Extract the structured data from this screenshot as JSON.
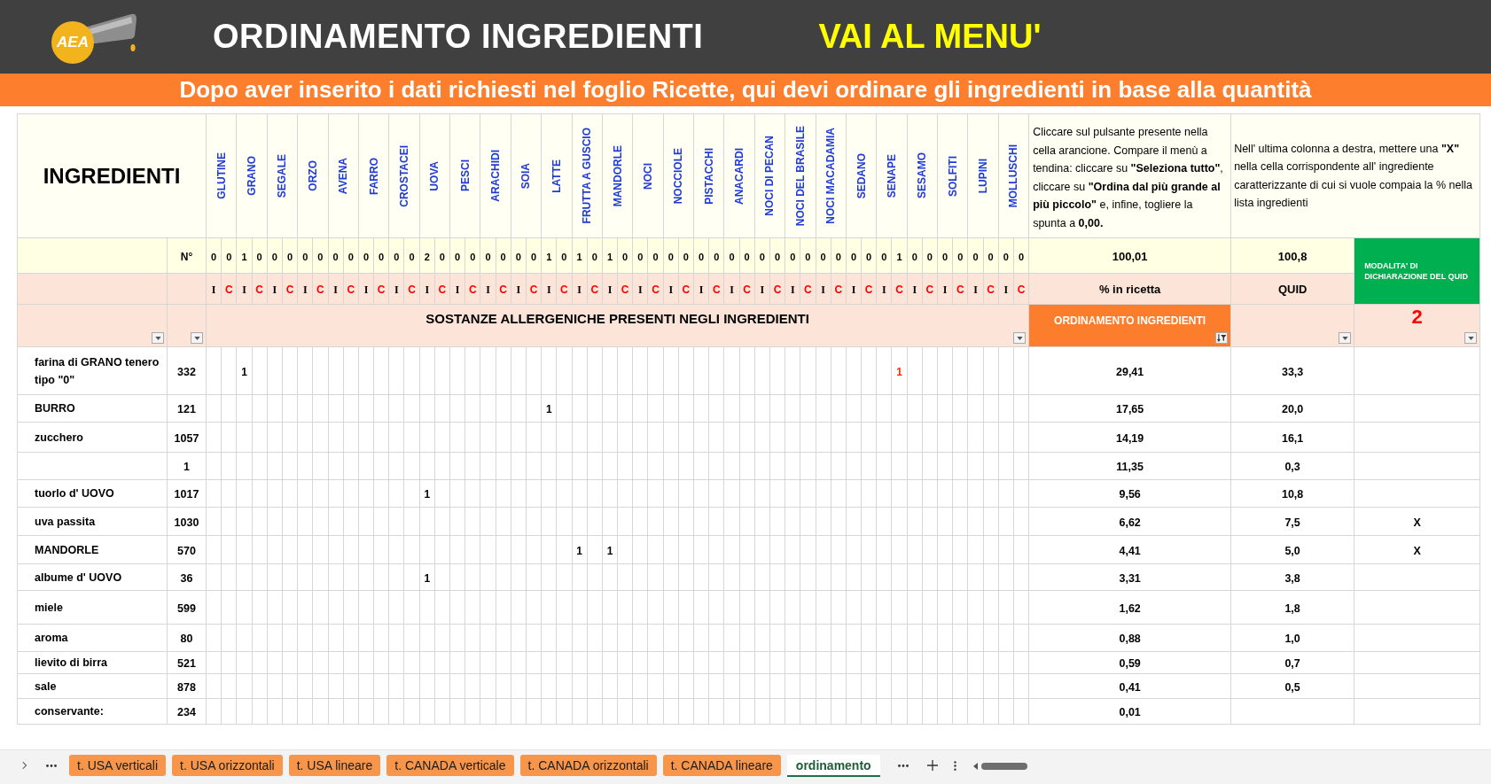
{
  "header": {
    "logo_text": "AEA",
    "title": "ORDINAMENTO INGREDIENTI",
    "menu_link": "VAI AL MENU'"
  },
  "banner": "Dopo aver inserito i dati richiesti nel foglio Ricette, qui devi ordinare gli ingredienti in base alla quantità",
  "table": {
    "ingredients_heading": "INGREDIENTI",
    "allergens": [
      {
        "name": "GLUTINE",
        "subcolumns": [
          {
            "kind": "I",
            "label": "I",
            "count": "0"
          },
          {
            "kind": "C",
            "label": "C",
            "count": "0"
          }
        ]
      },
      {
        "name": "GRANO",
        "subcolumns": [
          {
            "kind": "I",
            "label": "I",
            "count": "1"
          },
          {
            "kind": "C",
            "label": "C",
            "count": "0"
          }
        ]
      },
      {
        "name": "SEGALE",
        "subcolumns": [
          {
            "kind": "I",
            "label": "I",
            "count": "0"
          },
          {
            "kind": "C",
            "label": "C",
            "count": "0"
          }
        ]
      },
      {
        "name": "ORZO",
        "subcolumns": [
          {
            "kind": "I",
            "label": "I",
            "count": "0"
          },
          {
            "kind": "C",
            "label": "C",
            "count": "0"
          }
        ]
      },
      {
        "name": "AVENA",
        "subcolumns": [
          {
            "kind": "I",
            "label": "I",
            "count": "0"
          },
          {
            "kind": "C",
            "label": "C",
            "count": "0"
          }
        ]
      },
      {
        "name": "FARRO",
        "subcolumns": [
          {
            "kind": "I",
            "label": "I",
            "count": "0"
          },
          {
            "kind": "C",
            "label": "C",
            "count": "0"
          }
        ]
      },
      {
        "name": "CROSTACEI",
        "subcolumns": [
          {
            "kind": "I",
            "label": "I",
            "count": "0"
          },
          {
            "kind": "C",
            "label": "C",
            "count": "0"
          }
        ]
      },
      {
        "name": "UOVA",
        "subcolumns": [
          {
            "kind": "I",
            "label": "I",
            "count": "2"
          },
          {
            "kind": "C",
            "label": "C",
            "count": "0"
          }
        ]
      },
      {
        "name": "PESCI",
        "subcolumns": [
          {
            "kind": "I",
            "label": "I",
            "count": "0"
          },
          {
            "kind": "C",
            "label": "C",
            "count": "0"
          }
        ]
      },
      {
        "name": "ARACHIDI",
        "subcolumns": [
          {
            "kind": "I",
            "label": "I",
            "count": "0"
          },
          {
            "kind": "C",
            "label": "C",
            "count": "0"
          }
        ]
      },
      {
        "name": "SOIA",
        "subcolumns": [
          {
            "kind": "I",
            "label": "I",
            "count": "0"
          },
          {
            "kind": "C",
            "label": "C",
            "count": "0"
          }
        ]
      },
      {
        "name": "LATTE",
        "subcolumns": [
          {
            "kind": "I",
            "label": "I",
            "count": "1"
          },
          {
            "kind": "C",
            "label": "C",
            "count": "0"
          }
        ]
      },
      {
        "name": "FRUTTA A GUSCIO",
        "subcolumns": [
          {
            "kind": "I",
            "label": "I",
            "count": "1"
          },
          {
            "kind": "C",
            "label": "C",
            "count": "0"
          }
        ]
      },
      {
        "name": "MANDORLE",
        "subcolumns": [
          {
            "kind": "I",
            "label": "I",
            "count": "1"
          },
          {
            "kind": "C",
            "label": "C",
            "count": "0"
          }
        ]
      },
      {
        "name": "NOCI",
        "subcolumns": [
          {
            "kind": "I",
            "label": "I",
            "count": "0"
          },
          {
            "kind": "C",
            "label": "C",
            "count": "0"
          }
        ]
      },
      {
        "name": "NOCCIOLE",
        "subcolumns": [
          {
            "kind": "I",
            "label": "I",
            "count": "0"
          },
          {
            "kind": "C",
            "label": "C",
            "count": "0"
          }
        ]
      },
      {
        "name": "PISTACCHI",
        "subcolumns": [
          {
            "kind": "I",
            "label": "I",
            "count": "0"
          },
          {
            "kind": "C",
            "label": "C",
            "count": "0"
          }
        ]
      },
      {
        "name": "ANACARDI",
        "subcolumns": [
          {
            "kind": "I",
            "label": "I",
            "count": "0"
          },
          {
            "kind": "C",
            "label": "C",
            "count": "0"
          }
        ]
      },
      {
        "name": "NOCI DI PECAN",
        "subcolumns": [
          {
            "kind": "I",
            "label": "I",
            "count": "0"
          },
          {
            "kind": "C",
            "label": "C",
            "count": "0"
          }
        ]
      },
      {
        "name": "NOCI DEL BRASILE",
        "subcolumns": [
          {
            "kind": "I",
            "label": "I",
            "count": "0"
          },
          {
            "kind": "C",
            "label": "C",
            "count": "0"
          }
        ]
      },
      {
        "name": "NOCI MACADAMIA",
        "subcolumns": [
          {
            "kind": "I",
            "label": "I",
            "count": "0"
          },
          {
            "kind": "C",
            "label": "C",
            "count": "0"
          }
        ]
      },
      {
        "name": "SEDANO",
        "subcolumns": [
          {
            "kind": "I",
            "label": "I",
            "count": "0"
          },
          {
            "kind": "C",
            "label": "C",
            "count": "0"
          }
        ]
      },
      {
        "name": "SENAPE",
        "subcolumns": [
          {
            "kind": "I",
            "label": "I",
            "count": "0"
          },
          {
            "kind": "C",
            "label": "C",
            "count": "1"
          }
        ]
      },
      {
        "name": "SESAMO",
        "subcolumns": [
          {
            "kind": "I",
            "label": "I",
            "count": "0"
          },
          {
            "kind": "C",
            "label": "C",
            "count": "0"
          }
        ]
      },
      {
        "name": "SOLFITI",
        "subcolumns": [
          {
            "kind": "I",
            "label": "I",
            "count": "0"
          },
          {
            "kind": "C",
            "label": "C",
            "count": "0"
          }
        ]
      },
      {
        "name": "LUPINI",
        "subcolumns": [
          {
            "kind": "I",
            "label": "I",
            "count": "0"
          },
          {
            "kind": "C",
            "label": "C",
            "count": "0"
          }
        ]
      },
      {
        "name": "MOLLUSCHI",
        "subcolumns": [
          {
            "kind": "I",
            "label": "I",
            "count": "0"
          },
          {
            "kind": "C",
            "label": "C",
            "count": "0"
          }
        ]
      }
    ],
    "percent_note": "Cliccare sul pulsante presente nella cella arancione. Compare il menù a tendina: cliccare su **\"Seleziona tutto\"**, cliccare su **\"Ordina dal più grande al più piccolo\"** e, infine, togliere la spunta a **0,00.**",
    "quid_note": "Nell' ultima colonna a destra, mettere una **\"X\"** nella cella corrispondente all' ingrediente caratterizzante di cui si vuole compaia la % nella lista ingredienti",
    "count_label": "N°",
    "percent_total": "100,01",
    "quid_total": "100,8",
    "percent_heading": "% in ricetta",
    "quid_heading": "QUID",
    "quid_mode_heading": "MODALITA' DI DICHIARAZIONE DEL QUID",
    "allergens_heading": "SOSTANZE ALLERGENICHE PRESENTI NEGLI INGREDIENTI",
    "sort_heading": "ORDINAMENTO INGREDIENTI",
    "quid_mode": "2",
    "rows": [
      {
        "name": "farina di GRANO tenero tipo \"0\"",
        "code": "332",
        "allergen_cells": [
          {},
          {},
          {
            "value": "1"
          },
          {},
          {},
          {},
          {},
          {},
          {},
          {},
          {},
          {},
          {},
          {},
          {},
          {},
          {},
          {},
          {},
          {},
          {},
          {},
          {},
          {},
          {},
          {},
          {},
          {},
          {},
          {},
          {},
          {},
          {},
          {},
          {},
          {},
          {},
          {},
          {},
          {},
          {},
          {},
          {},
          {},
          {},
          {
            "value": "1"
          },
          {},
          {},
          {},
          {},
          {},
          {},
          {},
          {}
        ],
        "percent": "29,41",
        "quid": "33,3"
      },
      {
        "name": "BURRO",
        "code": "121",
        "allergen_cells": [
          {},
          {},
          {},
          {},
          {},
          {},
          {},
          {},
          {},
          {},
          {},
          {},
          {},
          {},
          {},
          {},
          {},
          {},
          {},
          {},
          {},
          {},
          {
            "value": "1"
          },
          {},
          {},
          {},
          {},
          {},
          {},
          {},
          {},
          {},
          {},
          {},
          {},
          {},
          {},
          {},
          {},
          {},
          {},
          {},
          {},
          {},
          {},
          {},
          {},
          {},
          {},
          {},
          {},
          {},
          {},
          {}
        ],
        "percent": "17,65",
        "quid": "20,0"
      },
      {
        "name": "zucchero",
        "code": "1057",
        "percent": "14,19",
        "quid": "16,1"
      },
      {
        "code": "1",
        "percent": "11,35",
        "quid": "0,3"
      },
      {
        "name": "tuorlo d' UOVO",
        "code": "1017",
        "allergen_cells": [
          {},
          {},
          {},
          {},
          {},
          {},
          {},
          {},
          {},
          {},
          {},
          {},
          {},
          {},
          {
            "value": "1"
          },
          {},
          {},
          {},
          {},
          {},
          {},
          {},
          {},
          {},
          {},
          {},
          {},
          {},
          {},
          {},
          {},
          {},
          {},
          {},
          {},
          {},
          {},
          {},
          {},
          {},
          {},
          {},
          {},
          {},
          {},
          {},
          {},
          {},
          {},
          {},
          {},
          {},
          {},
          {}
        ],
        "percent": "9,56",
        "quid": "10,8"
      },
      {
        "name": "uva passita",
        "code": "1030",
        "percent": "6,62",
        "quid": "7,5",
        "quid_mark": "X"
      },
      {
        "name": "MANDORLE",
        "code": "570",
        "allergen_cells": [
          {},
          {},
          {},
          {},
          {},
          {},
          {},
          {},
          {},
          {},
          {},
          {},
          {},
          {},
          {},
          {},
          {},
          {},
          {},
          {},
          {},
          {},
          {},
          {},
          {
            "value": "1"
          },
          {},
          {
            "value": "1"
          },
          {},
          {},
          {},
          {},
          {},
          {},
          {},
          {},
          {},
          {},
          {},
          {},
          {},
          {},
          {},
          {},
          {},
          {},
          {},
          {},
          {},
          {},
          {},
          {},
          {},
          {},
          {}
        ],
        "percent": "4,41",
        "quid": "5,0",
        "quid_mark": "X"
      },
      {
        "name": "albume d' UOVO",
        "code": "36",
        "allergen_cells": [
          {},
          {},
          {},
          {},
          {},
          {},
          {},
          {},
          {},
          {},
          {},
          {},
          {},
          {},
          {
            "value": "1"
          },
          {},
          {},
          {},
          {},
          {},
          {},
          {},
          {},
          {},
          {},
          {},
          {},
          {},
          {},
          {},
          {},
          {},
          {},
          {},
          {},
          {},
          {},
          {},
          {},
          {},
          {},
          {},
          {},
          {},
          {},
          {},
          {},
          {},
          {},
          {},
          {},
          {},
          {},
          {}
        ],
        "percent": "3,31",
        "quid": "3,8"
      },
      {
        "name": "miele",
        "code": "599",
        "percent": "1,62",
        "quid": "1,8"
      },
      {
        "name": "aroma",
        "code": "80",
        "percent": "0,88",
        "quid": "1,0"
      },
      {
        "name": "lievito di birra",
        "code": "521",
        "percent": "0,59",
        "quid": "0,7"
      },
      {
        "name": "sale",
        "code": "878",
        "percent": "0,41",
        "quid": "0,5"
      },
      {
        "name": "conservante:",
        "code": "234",
        "percent": "0,01"
      }
    ]
  },
  "sheet_tabs": [
    {
      "label": "t. USA verticali",
      "selected": false
    },
    {
      "label": "t. USA orizzontali",
      "selected": false
    },
    {
      "label": "t. USA lineare",
      "selected": false
    },
    {
      "label": "t. CANADA verticale",
      "selected": false
    },
    {
      "label": "t. CANADA orizzontali",
      "selected": false
    },
    {
      "label": "t. CANADA lineare",
      "selected": false
    },
    {
      "label": "ordinamento",
      "selected": true
    }
  ]
}
